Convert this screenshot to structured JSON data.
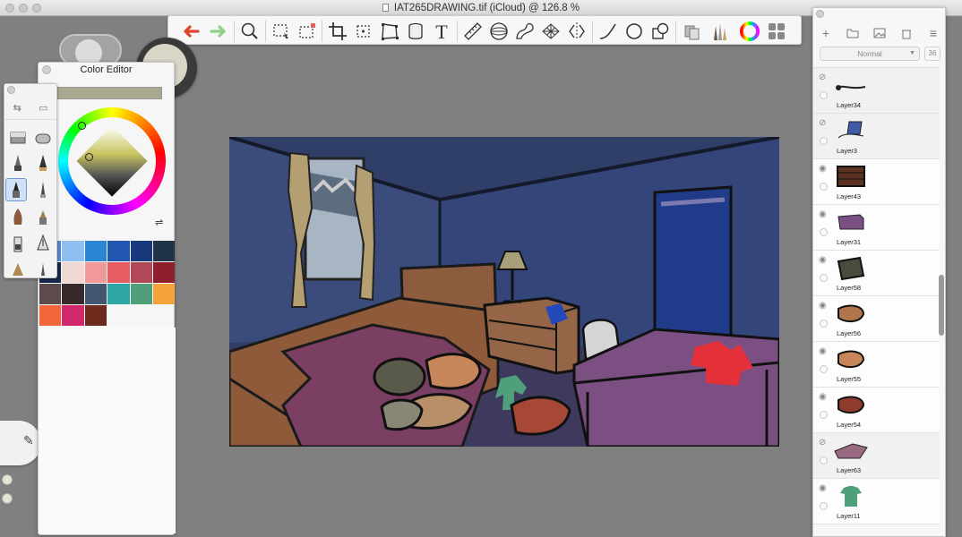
{
  "window": {
    "title": "IAT265DRAWING.tif (iCloud) @ 126.8 %"
  },
  "toolbar": {
    "tools": [
      {
        "name": "undo-icon",
        "color": "#e0442f"
      },
      {
        "name": "redo-icon",
        "color": "#8fd08a"
      },
      {
        "name": "zoom-icon"
      },
      {
        "name": "lasso-select-icon"
      },
      {
        "name": "selection-icon"
      },
      {
        "name": "crop-icon"
      },
      {
        "name": "transform-icon"
      },
      {
        "name": "distort-icon"
      },
      {
        "name": "fill-icon"
      },
      {
        "name": "text-icon"
      },
      {
        "name": "ruler-icon"
      },
      {
        "name": "ellipse-guide-icon"
      },
      {
        "name": "french-curve-icon"
      },
      {
        "name": "perspective-icon"
      },
      {
        "name": "symmetry-icon"
      },
      {
        "name": "line-icon"
      },
      {
        "name": "circle-icon"
      },
      {
        "name": "shape-icon"
      },
      {
        "name": "copic-icon"
      },
      {
        "name": "brush-library-icon"
      },
      {
        "name": "color-wheel-icon"
      },
      {
        "name": "layers-toggle-icon"
      }
    ]
  },
  "color_editor": {
    "title": "Color Editor",
    "current_color": "#a9a890",
    "palette": [
      "#5b87c8",
      "#8fbef1",
      "#2a86d3",
      "#2157b0",
      "#173a7c",
      "#213349",
      "#182a4a",
      "#f0d9d0",
      "#f19899",
      "#e65e61",
      "#b04858",
      "#8f1f2a",
      "#5c4a4c",
      "#362a2a",
      "#455770",
      "#2ea6a6",
      "#4fa07a",
      "#f4a33a",
      "#f2673a",
      "#d3276b",
      "#6e2a1c"
    ]
  },
  "brushes": {
    "selected_index": 4
  },
  "layers": {
    "blend_mode": "Normal",
    "opacity": "36",
    "items": [
      {
        "label": "Layer34",
        "visible": false,
        "thumb": "stroke"
      },
      {
        "label": "Layer3",
        "visible": false,
        "thumb": "laptop"
      },
      {
        "label": "Layer43",
        "visible": true,
        "thumb": "dresser"
      },
      {
        "label": "Layer31",
        "visible": true,
        "thumb": "box"
      },
      {
        "label": "Layer58",
        "visible": true,
        "thumb": "blob-dark"
      },
      {
        "label": "Layer56",
        "visible": true,
        "thumb": "pillow"
      },
      {
        "label": "Layer55",
        "visible": true,
        "thumb": "pillow-light"
      },
      {
        "label": "Layer54",
        "visible": true,
        "thumb": "pillow-red"
      },
      {
        "label": "Layer63",
        "visible": false,
        "thumb": "bed"
      },
      {
        "label": "Layer11",
        "visible": true,
        "thumb": "shirt"
      }
    ]
  }
}
